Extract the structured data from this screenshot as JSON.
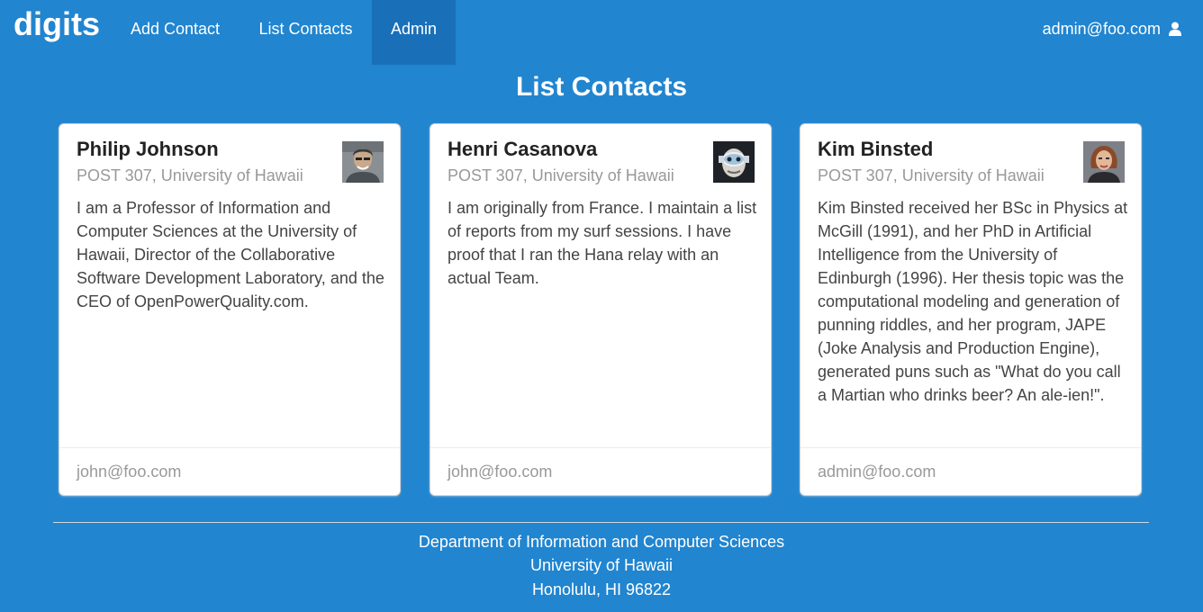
{
  "navbar": {
    "brand": "digits",
    "items": [
      {
        "label": "Add Contact"
      },
      {
        "label": "List Contacts"
      },
      {
        "label": "Admin",
        "active": true
      }
    ],
    "user": "admin@foo.com",
    "user_icon": "user-icon"
  },
  "page": {
    "title": "List Contacts"
  },
  "contacts": [
    {
      "name": "Philip Johnson",
      "address": "POST 307, University of Hawaii",
      "description": "I am a Professor of Information and Computer Sciences at the University of Hawaii, Director of the Collaborative Software Development Laboratory, and the CEO of OpenPowerQuality.com.",
      "owner": "john@foo.com"
    },
    {
      "name": "Henri Casanova",
      "address": "POST 307, University of Hawaii",
      "description": "I am originally from France. I maintain a list of reports from my surf sessions. I have proof that I ran the Hana relay with an actual Team.",
      "owner": "john@foo.com"
    },
    {
      "name": "Kim Binsted",
      "address": "POST 307, University of Hawaii",
      "description": "Kim Binsted received her BSc in Physics at McGill (1991), and her PhD in Artificial Intelligence from the University of Edinburgh (1996). Her thesis topic was the computational modeling and generation of punning riddles, and her program, JAPE (Joke Analysis and Production Engine), generated puns such as \"What do you call a Martian who drinks beer? An ale-ien!\".",
      "owner": "admin@foo.com"
    }
  ],
  "footer": {
    "line1": "Department of Information and Computer Sciences",
    "line2": "University of Hawaii",
    "line3": "Honolulu, HI 96822"
  },
  "colors": {
    "background": "#2185d0",
    "active_nav": "#1a70b8",
    "card": "#ffffff"
  }
}
